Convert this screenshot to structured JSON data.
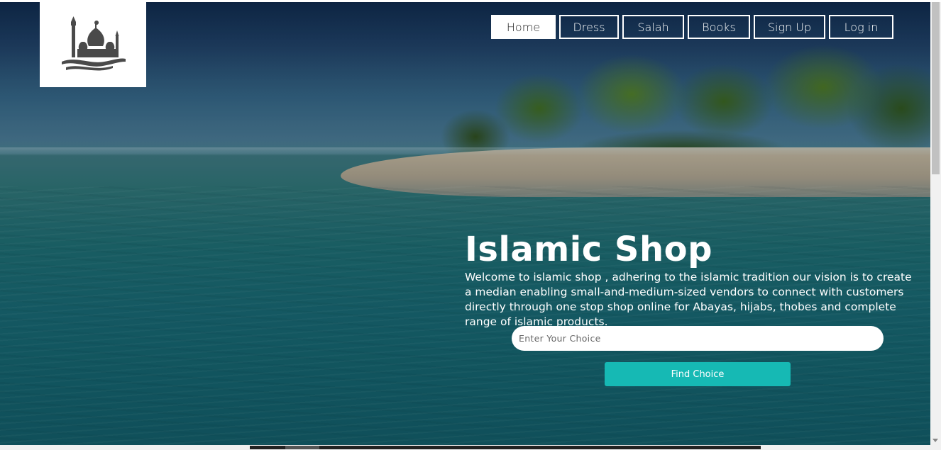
{
  "nav": {
    "items": [
      {
        "label": "Home",
        "active": true
      },
      {
        "label": "Dress",
        "active": false
      },
      {
        "label": "Salah",
        "active": false
      },
      {
        "label": "Books",
        "active": false
      },
      {
        "label": "Sign Up",
        "active": false
      },
      {
        "label": "Log in",
        "active": false
      }
    ]
  },
  "logo": {
    "icon": "mosque-icon",
    "color": "#4a4a4a"
  },
  "hero": {
    "title": "Islamic Shop",
    "description": "Welcome to islamic shop , adhering to the islamic tradition our vision is to create a median enabling small-and-medium-sized vendors to connect with customers directly through one stop shop online for Abayas, hijabs, thobes and complete range of islamic products."
  },
  "search": {
    "placeholder": "Enter Your Choice",
    "value": ""
  },
  "find_button": {
    "label": "Find Choice",
    "color": "#16b9b4"
  }
}
